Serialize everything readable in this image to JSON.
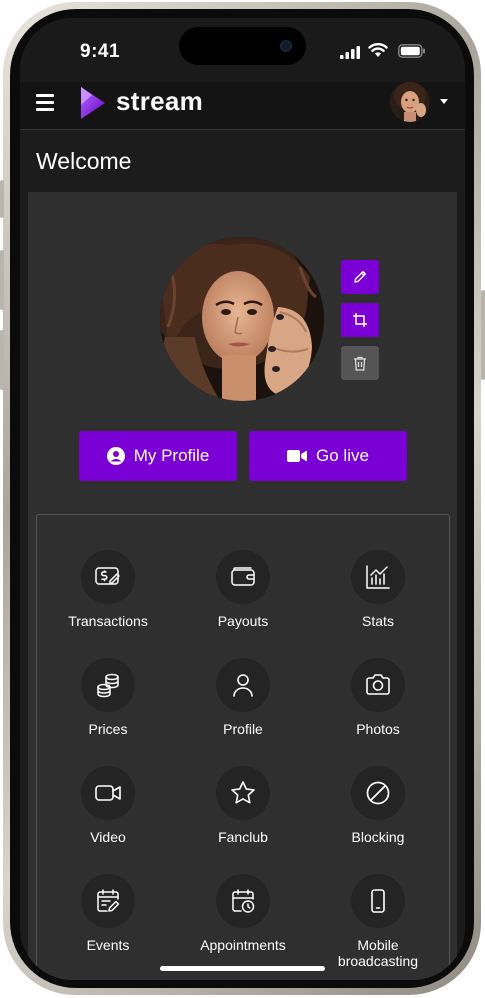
{
  "status_bar": {
    "time": "9:41"
  },
  "header": {
    "brand": "stream"
  },
  "page": {
    "title": "Welcome"
  },
  "profile_actions": {
    "my_profile": "My Profile",
    "go_live": "Go live"
  },
  "menu": {
    "items": [
      {
        "label": "Transactions",
        "icon": "transactions-icon"
      },
      {
        "label": "Payouts",
        "icon": "wallet-icon"
      },
      {
        "label": "Stats",
        "icon": "stats-icon"
      },
      {
        "label": "Prices",
        "icon": "coins-icon"
      },
      {
        "label": "Profile",
        "icon": "user-icon"
      },
      {
        "label": "Photos",
        "icon": "camera-icon"
      },
      {
        "label": "Video",
        "icon": "video-icon"
      },
      {
        "label": "Fanclub",
        "icon": "star-icon"
      },
      {
        "label": "Blocking",
        "icon": "block-icon"
      },
      {
        "label": "Events",
        "icon": "calendar-edit-icon"
      },
      {
        "label": "Appointments",
        "icon": "calendar-clock-icon"
      },
      {
        "label": "Mobile broadcasting",
        "icon": "mobile-icon"
      }
    ]
  },
  "colors": {
    "accent": "#7a00d6",
    "background": "#2f2f2f",
    "header": "#141414"
  }
}
